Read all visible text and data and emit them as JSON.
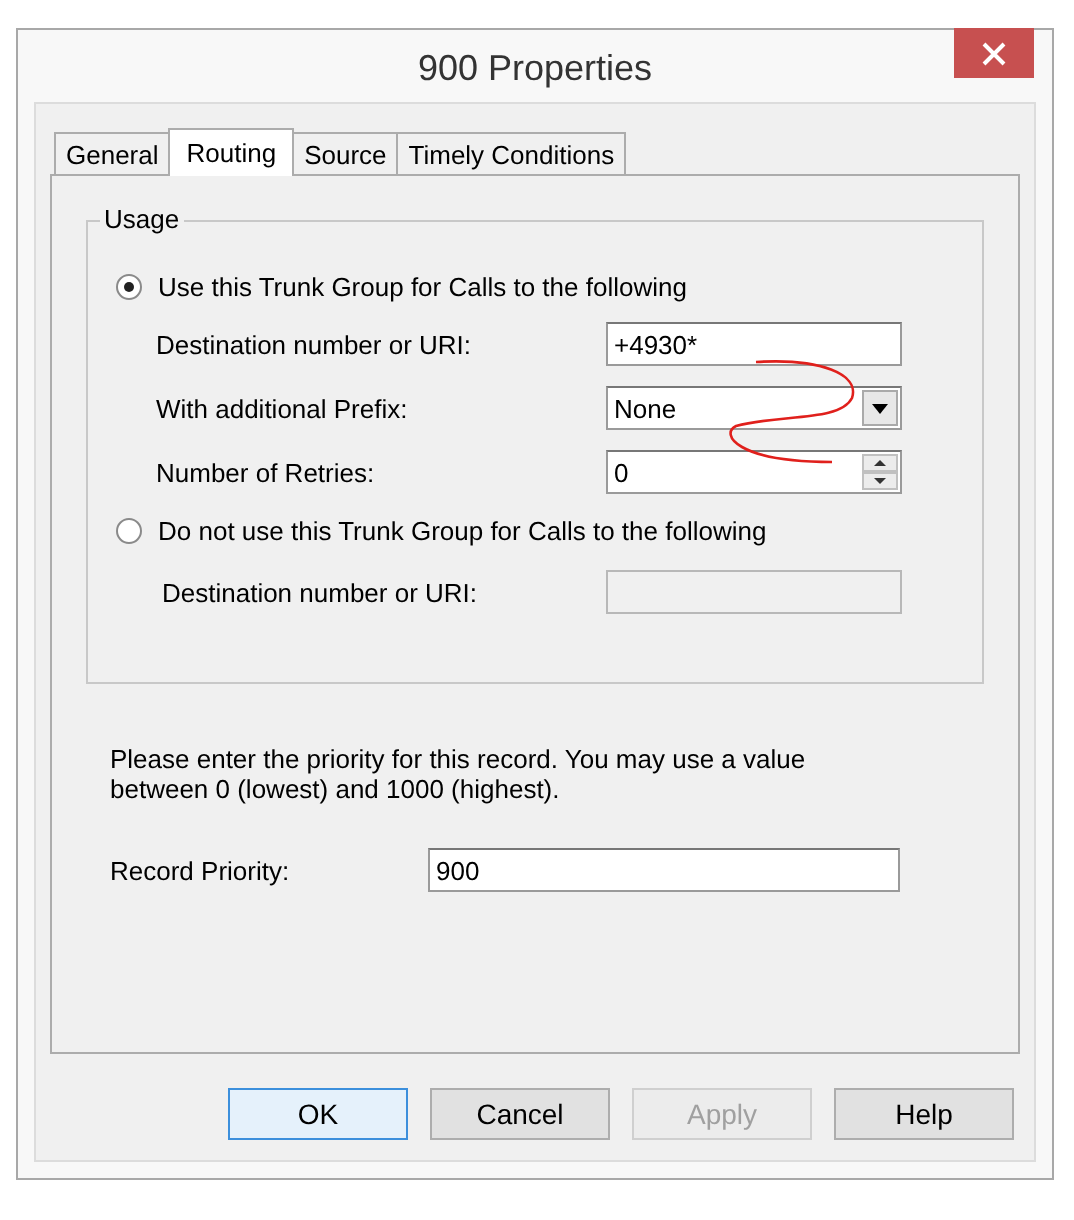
{
  "window": {
    "title": "900 Properties"
  },
  "tabs": [
    {
      "label": "General",
      "selected": false
    },
    {
      "label": "Routing",
      "selected": true
    },
    {
      "label": "Source",
      "selected": false
    },
    {
      "label": "Timely Conditions",
      "selected": false
    }
  ],
  "usage": {
    "title": "Usage",
    "options": [
      {
        "label": "Use this Trunk Group for Calls to the following",
        "selected": true,
        "fields": [
          {
            "kind": "text",
            "label": "Destination number or URI:",
            "value": "+4930*",
            "disabled": false
          },
          {
            "kind": "dropdown",
            "label": "With additional Prefix:",
            "value": "None",
            "disabled": false
          },
          {
            "kind": "spinner",
            "label": "Number of Retries:",
            "value": "0",
            "disabled": false
          }
        ]
      },
      {
        "label": "Do not use this Trunk Group for Calls to the following",
        "selected": false,
        "fields": [
          {
            "kind": "text",
            "label": "Destination number or URI:",
            "disabled": true
          }
        ]
      }
    ]
  },
  "priority": {
    "hint": "Please enter the priority for this record. You may use a value between 0 (lowest) and 1000 (highest).",
    "label": "Record Priority:",
    "value": "900"
  },
  "buttons": [
    {
      "label": "OK",
      "default": true,
      "disabled": false
    },
    {
      "label": "Cancel",
      "default": false,
      "disabled": false
    },
    {
      "label": "Apply",
      "default": false,
      "disabled": true
    },
    {
      "label": "Help",
      "default": false,
      "disabled": false
    }
  ]
}
